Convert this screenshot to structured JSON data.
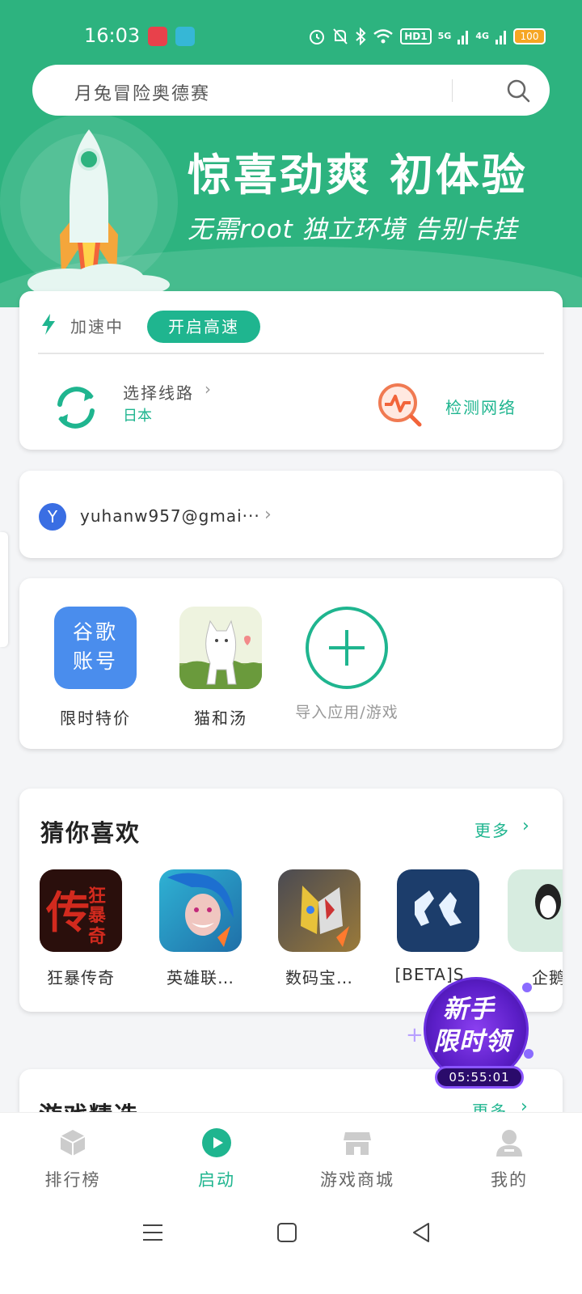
{
  "status_bar": {
    "time": "16:03",
    "hd": "HD1",
    "net1": "5G",
    "net2": "4G",
    "battery": "100"
  },
  "search": {
    "placeholder": "月兔冒险奥德赛"
  },
  "banner": {
    "title": "惊喜劲爽 初体验",
    "subtitle": "无需root 独立环境 告别卡挂"
  },
  "accelerator": {
    "status": "加速中",
    "boost_button": "开启高速",
    "route_label": "选择线路",
    "route_value": "日本",
    "detect_label": "检测网络"
  },
  "account": {
    "avatar_letter": "Y",
    "email": "yuhanw957@gmai···"
  },
  "apps": [
    {
      "icon_text_1": "谷歌",
      "icon_text_2": "账号",
      "label": "限时特价"
    },
    {
      "label": "猫和汤"
    },
    {
      "label": "导入应用/游戏"
    }
  ],
  "guess": {
    "title": "猜你喜欢",
    "more": "更多",
    "games": [
      {
        "name": "狂暴传奇"
      },
      {
        "name": "英雄联…"
      },
      {
        "name": "数码宝…"
      },
      {
        "name": "[BETA]S…"
      },
      {
        "name": "企鹅"
      }
    ]
  },
  "picks": {
    "title": "游戏精选",
    "more": "更多"
  },
  "promo": {
    "line1": "新手",
    "line2": "限时领",
    "timer": "05:55:01"
  },
  "bottom_nav": [
    {
      "label": "排行榜"
    },
    {
      "label": "启动",
      "active": true
    },
    {
      "label": "游戏商城"
    },
    {
      "label": "我的"
    }
  ],
  "colors": {
    "brand_green": "#2db37f",
    "accent_teal": "#1fb58f"
  }
}
